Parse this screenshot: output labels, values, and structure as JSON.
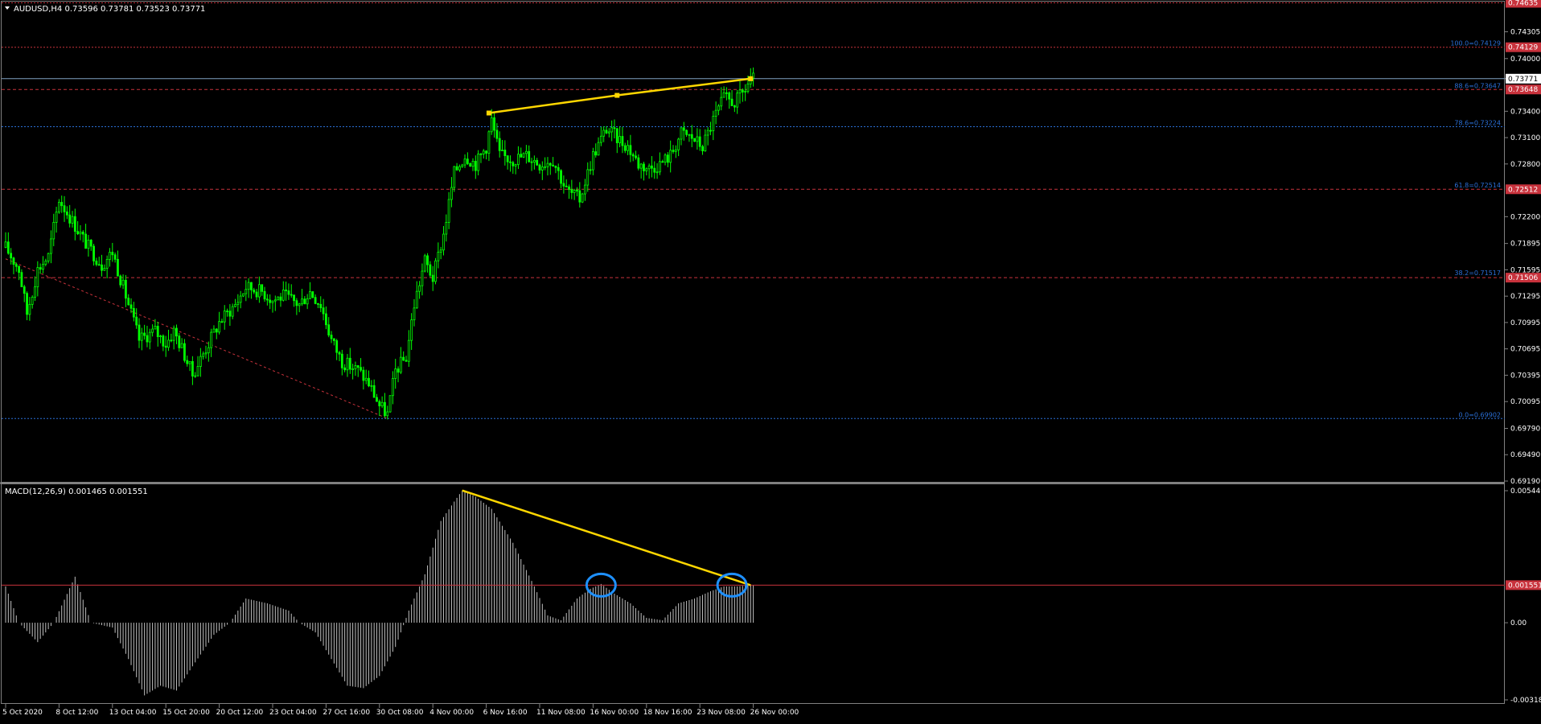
{
  "chart_data": [
    {
      "type": "candlestick",
      "title": "AUDUSD,H4  0.73596 0.73781 0.73523 0.73771",
      "symbol": "AUDUSD,H4",
      "ohlc": [
        "0.73596",
        "0.73781",
        "0.73523",
        "0.73771"
      ],
      "ylim": [
        0.6919,
        0.7463
      ],
      "y_ticks": [
        "0.74305",
        "0.74000",
        "0.73771",
        "0.73400",
        "0.73100",
        "0.72800",
        "0.72200",
        "0.71895",
        "0.71595",
        "0.71295",
        "0.70995",
        "0.70695",
        "0.70395",
        "0.70095",
        "0.69790",
        "0.69490",
        "0.69190"
      ],
      "current_price": 0.73771,
      "current_price_label": "0.73771",
      "horizontal_lines": [
        {
          "price": 0.74129,
          "label": "0.74129",
          "color": "#c8323c",
          "style": "dotted"
        },
        {
          "price": 0.73648,
          "label": "0.73648",
          "color": "#c8323c",
          "style": "dashed"
        },
        {
          "price": 0.73224,
          "label": "",
          "color": "#2a6fd6",
          "style": "dotted"
        },
        {
          "price": 0.72512,
          "label": "0.72512",
          "color": "#c8323c",
          "style": "dashed"
        },
        {
          "price": 0.71506,
          "label": "0.71506",
          "color": "#c8323c",
          "style": "dashed"
        },
        {
          "price": 0.69902,
          "label": "",
          "color": "#2a6fd6",
          "style": "dotted"
        },
        {
          "price": 0.74635,
          "label": "0.74635",
          "color": "#c8323c",
          "style": "dotted"
        }
      ],
      "fib_labels": [
        {
          "text": "100.0=0.74129",
          "price": 0.74129
        },
        {
          "text": "88.6=0.73647",
          "price": 0.73647
        },
        {
          "text": "78.6=0.73224",
          "price": 0.73224
        },
        {
          "text": "61.8=0.72514",
          "price": 0.72514
        },
        {
          "text": "38.2=0.71517",
          "price": 0.71517
        },
        {
          "text": "0.0=0.69902",
          "price": 0.69902
        }
      ],
      "trendline_price": [
        {
          "bar": 0,
          "price": 0.7338
        },
        {
          "bar": 1,
          "price": 0.73581
        },
        {
          "bar": 2,
          "price": 0.73771
        }
      ],
      "trendline_bars": [
        181,
        229,
        279
      ],
      "fib_baseline": {
        "from_bar": 0,
        "from_price": 0.7172,
        "to_bar": 143,
        "to_price": 0.69902
      },
      "colors": {
        "candle": "#00ff00",
        "trend": "#ffd700",
        "background": "#000000",
        "grid": "#808080"
      }
    },
    {
      "type": "histogram",
      "title": "MACD(12,26,9) 0.001465 0.001551",
      "ylim": [
        -0.003185,
        0.005449
      ],
      "y_ticks": [
        "0.005449",
        "0.00",
        "-0.003185"
      ],
      "signal_level": 0.001551,
      "signal_label": "0.001551",
      "trendline_bars": [
        171,
        279
      ],
      "trendline_values": [
        0.00546,
        0.001551
      ],
      "circled_bars": [
        223,
        272
      ],
      "colors": {
        "histogram": "#c0c0c0",
        "trend": "#ffd700",
        "circle": "#1e90ff",
        "signal": "#c8323c"
      }
    }
  ],
  "x_axis": {
    "labels": [
      "5 Oct 2020",
      "8 Oct 12:00",
      "13 Oct 04:00",
      "15 Oct 20:00",
      "20 Oct 12:00",
      "23 Oct 04:00",
      "27 Oct 16:00",
      "30 Oct 08:00",
      "4 Nov 00:00",
      "6 Nov 16:00",
      "11 Nov 08:00",
      "16 Nov 00:00",
      "18 Nov 16:00",
      "23 Nov 08:00",
      "26 Nov 00:00"
    ],
    "label_bars": [
      0,
      20,
      40,
      60,
      80,
      100,
      120,
      140,
      160,
      180,
      200,
      220,
      240,
      260,
      280
    ]
  },
  "bars": 281
}
